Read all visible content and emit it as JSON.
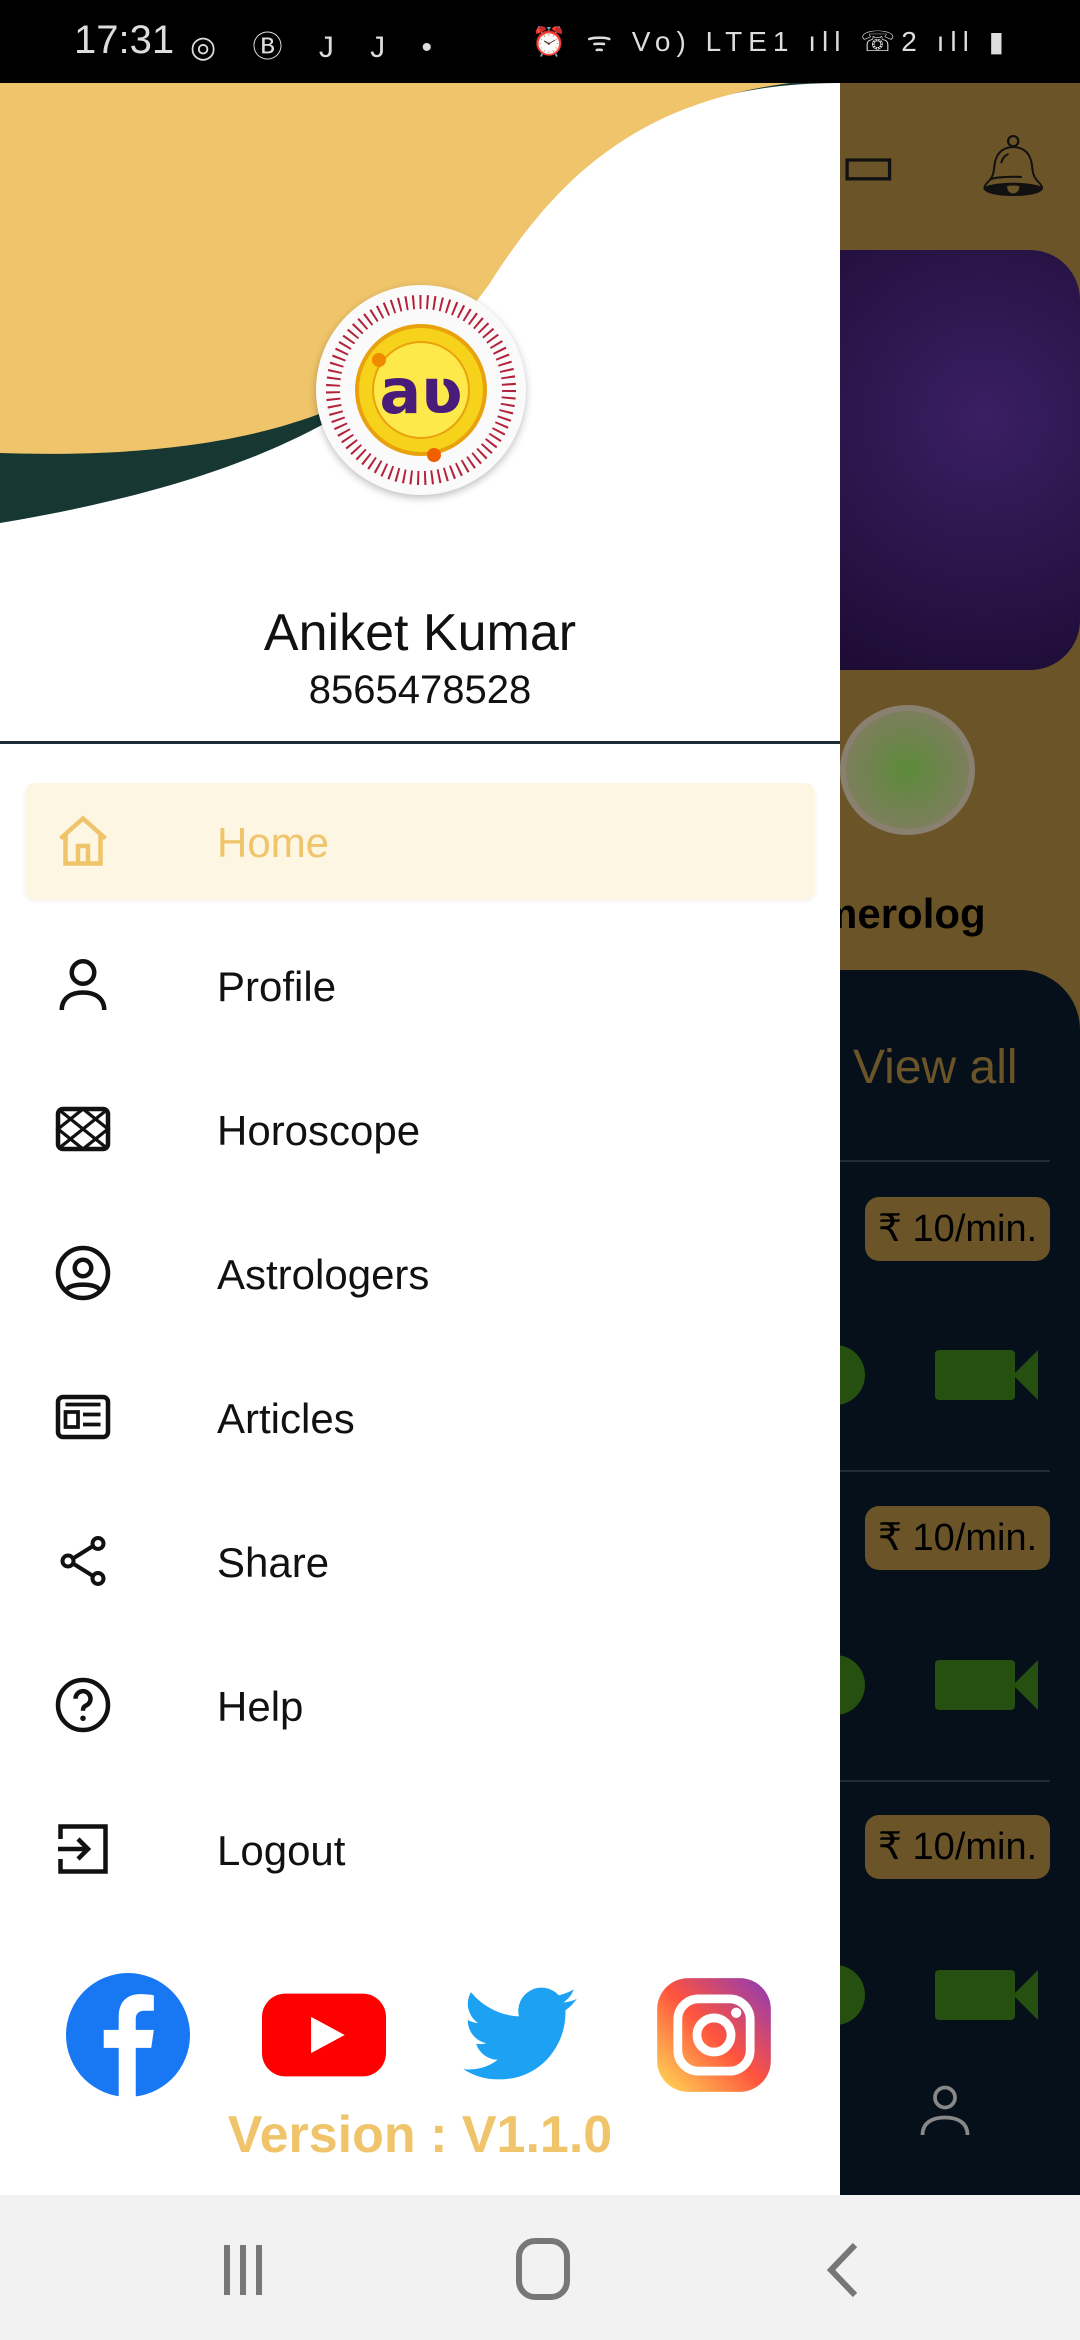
{
  "status_bar": {
    "time": "17:31",
    "left_icons": "◎ Ⓑ J J •",
    "right_icons": "⏰ ᯤ Vo) LTE1 ıll ☏2 ıll ▮"
  },
  "background": {
    "partial_label": "merolog",
    "view_all": "View all",
    "price": "₹ 10/min."
  },
  "drawer": {
    "user_name": "Aniket Kumar",
    "phone": "8565478528",
    "menu": [
      {
        "label": "Home",
        "icon": "home-icon",
        "active": true
      },
      {
        "label": "Profile",
        "icon": "person-icon"
      },
      {
        "label": "Horoscope",
        "icon": "horoscope-icon"
      },
      {
        "label": "Astrologers",
        "icon": "account-circle-icon"
      },
      {
        "label": "Articles",
        "icon": "newspaper-icon"
      },
      {
        "label": "Share",
        "icon": "share-icon"
      },
      {
        "label": "Help",
        "icon": "help-icon"
      },
      {
        "label": "Logout",
        "icon": "logout-icon"
      }
    ],
    "social": [
      "facebook",
      "youtube",
      "twitter",
      "instagram"
    ],
    "version": "Version : V1.1.0"
  },
  "colors": {
    "accent": "#EFC46A",
    "dark": "#173733",
    "highlight": "#fdf6e3"
  }
}
